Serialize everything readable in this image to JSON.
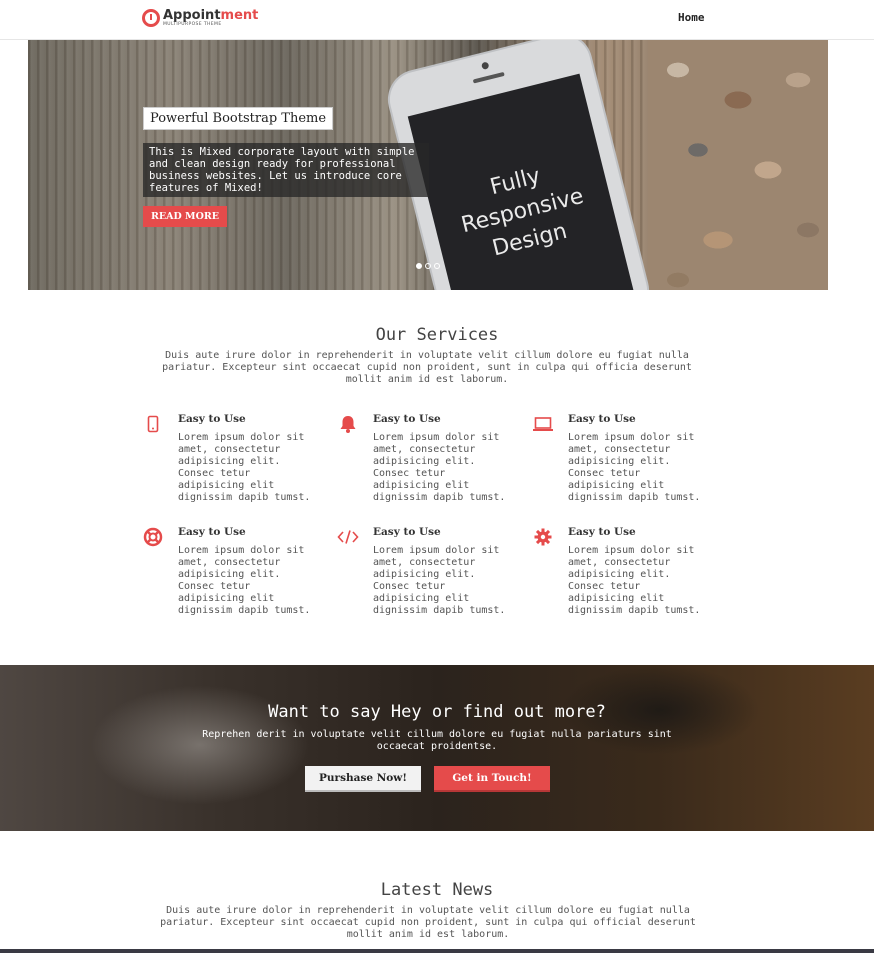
{
  "header": {
    "logo_main_a": "Appoint",
    "logo_main_b": "ment",
    "logo_sub": "MULTIPURPOSE THEME",
    "nav_home": "Home"
  },
  "hero": {
    "title": "Powerful Bootstrap Theme",
    "description": "This is Mixed corporate layout with simple and clean design ready for professional business websites. Let us introduce core features of Mixed!",
    "button": "READ MORE",
    "phone_screen_text": "Fully\nResponsive\nDesign",
    "slides_total": 3,
    "slide_active": 1
  },
  "services": {
    "title": "Our Services",
    "description": "Duis aute irure dolor in reprehenderit in voluptate velit cillum dolore eu fugiat nulla pariatur. Excepteur sint occaecat cupid non proident, sunt in culpa qui officia deserunt mollit anim id est laborum.",
    "items": [
      {
        "icon": "mobile-icon",
        "title": "Easy to Use",
        "text": "Lorem ipsum dolor sit\namet, consectetur\nadipisicing elit.\nConsec tetur\nadipisicing elit\ndignissim dapib tumst."
      },
      {
        "icon": "bell-icon",
        "title": "Easy to Use",
        "text": "Lorem ipsum dolor sit\namet, consectetur\nadipisicing elit.\nConsec tetur\nadipisicing elit\ndignissim dapib tumst."
      },
      {
        "icon": "laptop-icon",
        "title": "Easy to Use",
        "text": "Lorem ipsum dolor sit\namet, consectetur\nadipisicing elit.\nConsec tetur\nadipisicing elit\ndignissim dapib tumst."
      },
      {
        "icon": "lifebuoy-icon",
        "title": "Easy to Use",
        "text": "Lorem ipsum dolor sit\namet, consectetur\nadipisicing elit.\nConsec tetur\nadipisicing elit\ndignissim dapib tumst."
      },
      {
        "icon": "code-icon",
        "title": "Easy to Use",
        "text": "Lorem ipsum dolor sit\namet, consectetur\nadipisicing elit.\nConsec tetur\nadipisicing elit\ndignissim dapib tumst."
      },
      {
        "icon": "gear-icon",
        "title": "Easy to Use",
        "text": "Lorem ipsum dolor sit\namet, consectetur\nadipisicing elit.\nConsec tetur\nadipisicing elit\ndignissim dapib tumst."
      }
    ]
  },
  "cta": {
    "title": "Want to say Hey or find out more?",
    "text": "Reprehen derit in voluptate velit cillum dolore eu fugiat nulla pariaturs sint occaecat proidentse.",
    "btn_purchase": "Purshase Now!",
    "btn_touch": "Get in Touch!"
  },
  "news": {
    "title": "Latest News",
    "description": "Duis aute irure dolor in reprehenderit in voluptate velit cillum dolore eu fugiat nulla pariatur. Excepteur sint occaecat cupid non proident, sunt in culpa qui official deserunt mollit anim id est laborum."
  },
  "colors": {
    "accent": "#e54b4b",
    "text": "#333333"
  }
}
